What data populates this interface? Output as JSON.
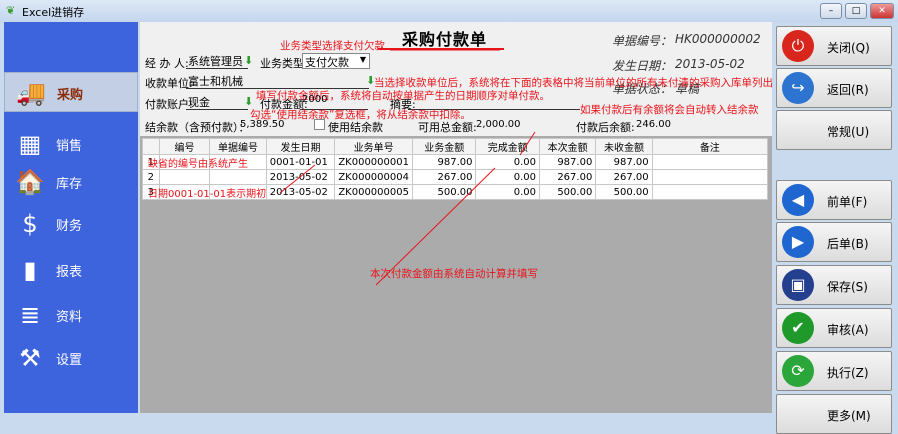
{
  "window": {
    "title": "Excel进销存",
    "minimize": "–",
    "maximize": "□",
    "close": "✕"
  },
  "sidebar": {
    "items": [
      {
        "label": "采购",
        "icon": "truck-icon",
        "glyph": "🚚",
        "active": true
      },
      {
        "label": "销售",
        "icon": "pos-terminal-icon",
        "glyph": "▦"
      },
      {
        "label": "库存",
        "icon": "house-icon",
        "glyph": "🏠"
      },
      {
        "label": "财务",
        "icon": "card-dollar-icon",
        "glyph": "$"
      },
      {
        "label": "报表",
        "icon": "blocks-chart-icon",
        "glyph": "▮"
      },
      {
        "label": "资料",
        "icon": "books-icon",
        "glyph": "≣"
      },
      {
        "label": "设置",
        "icon": "tools-icon",
        "glyph": "⚒"
      }
    ]
  },
  "form": {
    "title": "采购付款单",
    "doc_no_label": "单据编号：",
    "doc_no": "HK000000002",
    "date_label": "发生日期：",
    "date": "2013-05-02",
    "status_label": "单据状态：",
    "status": "草稿",
    "handler_label": "经 办 人:",
    "handler": "系统管理员",
    "biz_type_label": "业务类型:",
    "biz_type": "支付欠款",
    "payee_label": "收款单位:",
    "payee": "富士和机械",
    "account_label": "付款账户:",
    "account": "现金",
    "pay_amount_label": "付款金额:",
    "pay_amount": "2000",
    "memo_label": "摘要:",
    "balance_label": "结余款（含预付款）：",
    "balance": "5,389.50",
    "use_balance_label": "使用结余款",
    "available_label": "可用总金额:",
    "available": "2,000.00",
    "after_label": "付款后余额:",
    "after": "246.00"
  },
  "annotations": {
    "biz_type": "业务类型选择支付欠款",
    "payee": "当选择收款单位后，系统将在下面的表格中将当前单位的所有未付清的采购入库单列出。",
    "amount": "填写付款金额后，系统将自动按单据产生的日期顺序对单付款。",
    "use_balance": "勾选“使用结余款”复选框，将从结余款中扣除。",
    "leftover": "如果付款后有余额将会自动转入结余款",
    "code": "缺省的编号由系统产生",
    "opening": "日期0001-01-01表示期初",
    "auto_calc": "本次付款金额由系统自动计算并填写"
  },
  "table": {
    "headers": [
      "",
      "编号",
      "单据编号",
      "发生日期",
      "业务单号",
      "业务金额",
      "完成金额",
      "本次金额",
      "未收金额",
      "备注"
    ],
    "rows": [
      [
        "1",
        "",
        "",
        "0001-01-01",
        "ZK000000001",
        "987.00",
        "0.00",
        "987.00",
        "987.00",
        ""
      ],
      [
        "2",
        "",
        "",
        "2013-05-02",
        "ZK000000004",
        "267.00",
        "0.00",
        "267.00",
        "267.00",
        ""
      ],
      [
        "3",
        "",
        "",
        "2013-05-02",
        "ZK000000005",
        "500.00",
        "0.00",
        "500.00",
        "500.00",
        ""
      ]
    ]
  },
  "buttons": [
    {
      "label": "关闭(Q)",
      "icon": "power-icon",
      "glyph": "⏻",
      "color": "#d8261c"
    },
    {
      "label": "返回(R)",
      "icon": "return-icon",
      "glyph": "↪",
      "color": "#2c74d0"
    },
    {
      "label": "常规(U)",
      "icon": "",
      "glyph": "",
      "color": ""
    },
    {
      "label": "前单(F)",
      "icon": "previous-icon",
      "glyph": "◀",
      "color": "#1f66d0"
    },
    {
      "label": "后单(B)",
      "icon": "next-icon",
      "glyph": "▶",
      "color": "#1f66d0"
    },
    {
      "label": "保存(S)",
      "icon": "floppy-disk-icon",
      "glyph": "▣",
      "color": "#233f8e"
    },
    {
      "label": "审核(A)",
      "icon": "shield-check-icon",
      "glyph": "✔",
      "color": "#1f9a2a"
    },
    {
      "label": "执行(Z)",
      "icon": "refresh-icon",
      "glyph": "⟳",
      "color": "#2aa63a"
    },
    {
      "label": "更多(M)",
      "icon": "",
      "glyph": "",
      "color": ""
    }
  ]
}
